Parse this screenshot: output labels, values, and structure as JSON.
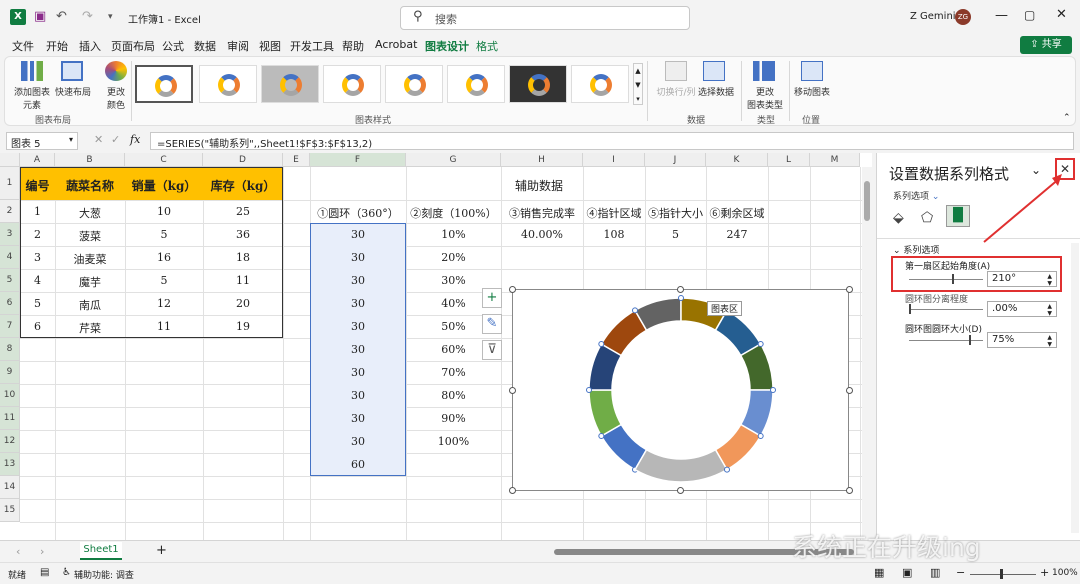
{
  "titlebar": {
    "workbook": "工作簿1",
    "separator": "-",
    "app": "Excel",
    "search_placeholder": "搜索",
    "user": "Z Gemini",
    "avatar": "ZG"
  },
  "menu": [
    "文件",
    "开始",
    "插入",
    "页面布局",
    "公式",
    "数据",
    "审阅",
    "视图",
    "开发工具",
    "帮助",
    "Acrobat",
    "图表设计",
    "格式"
  ],
  "menu_active": "图表设计",
  "share_label": "共享",
  "ribbon": {
    "add_element": "添加图表\n元素",
    "quick_layout": "快速布局",
    "change_color": "更改\n颜色",
    "group_chart_layout": "图表布局",
    "group_chart_style": "图表样式",
    "switch_row_col": "切换行/列",
    "select_data": "选择数据",
    "group_data": "数据",
    "change_type": "更改\n图表类型",
    "group_type": "类型",
    "move_chart": "移动图表",
    "group_location": "位置"
  },
  "formula_bar": {
    "name_box": "图表 5",
    "fx": "fx",
    "formula": "=SERIES(\"辅助系列\",,Sheet1!$F$3:$F$13,2)"
  },
  "columns": [
    "A",
    "B",
    "C",
    "D",
    "E",
    "F",
    "G",
    "H",
    "I",
    "J",
    "K",
    "L",
    "M"
  ],
  "rows": [
    "1",
    "2",
    "3",
    "4",
    "5",
    "6",
    "7",
    "8",
    "9",
    "10",
    "11",
    "12",
    "13",
    "14",
    "15"
  ],
  "table1": {
    "headers": [
      "编号",
      "蔬菜名称",
      "销量（kg）",
      "库存（kg）"
    ],
    "rows": [
      [
        "1",
        "大葱",
        "10",
        "25"
      ],
      [
        "2",
        "菠菜",
        "5",
        "36"
      ],
      [
        "3",
        "油麦菜",
        "16",
        "18"
      ],
      [
        "4",
        "魔芋",
        "5",
        "11"
      ],
      [
        "5",
        "南瓜",
        "12",
        "20"
      ],
      [
        "6",
        "芹菜",
        "11",
        "19"
      ]
    ]
  },
  "aux": {
    "title": "辅助数据",
    "headers": [
      "①圆环（360°）",
      "②刻度（100%）",
      "③销售完成率",
      "④指针区域",
      "⑤指针大小",
      "⑥剩余区域"
    ],
    "ring": [
      "30",
      "30",
      "30",
      "30",
      "30",
      "30",
      "30",
      "30",
      "30",
      "30",
      "60"
    ],
    "scale": [
      "10%",
      "20%",
      "30%",
      "40%",
      "50%",
      "60%",
      "70%",
      "80%",
      "90%",
      "100%"
    ],
    "completion": "40.00%",
    "pointer_area": "108",
    "pointer_size": "5",
    "remaining": "247"
  },
  "chart_tooltip": "图表区",
  "donut": {
    "values": [
      30,
      30,
      30,
      30,
      30,
      30,
      30,
      30,
      30,
      30,
      60
    ],
    "start_angle": 210,
    "hole": 0.75,
    "colors": [
      "#4472c4",
      "#70ad47",
      "#264478",
      "#9e480e",
      "#636363",
      "#997300",
      "#255e91",
      "#43682b",
      "#698ed0",
      "#f1975a",
      "#b7b7b7",
      "#ffc000"
    ]
  },
  "pane": {
    "title": "设置数据系列格式",
    "series_options_dropdown": "系列选项",
    "section": "系列选项",
    "first_angle_label": "第一扇区起始角度(A)",
    "first_angle_value": "210°",
    "explosion_label": "圆环图分离程度",
    "explosion_value": ".00%",
    "hole_label": "圆环图圆环大小(D)",
    "hole_value": "75%"
  },
  "sheet_tab": "Sheet1",
  "status": {
    "ready": "就绪",
    "accessibility": "辅助功能: 调查",
    "zoom": "100%"
  },
  "watermark": "系统正在升级ing"
}
